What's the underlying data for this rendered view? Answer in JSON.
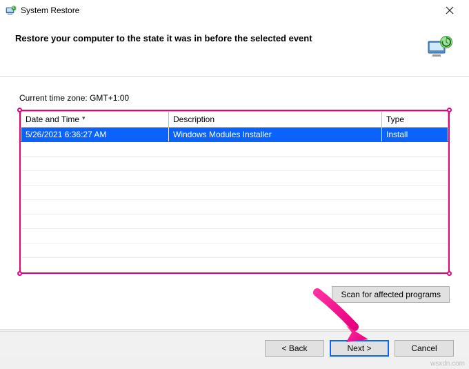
{
  "window": {
    "title": "System Restore"
  },
  "header": {
    "heading": "Restore your computer to the state it was in before the selected event"
  },
  "content": {
    "timezone_label": "Current time zone: GMT+1:00",
    "columns": {
      "datetime": "Date and Time",
      "description": "Description",
      "type": "Type"
    },
    "rows": [
      {
        "datetime": "5/26/2021 6:36:27 AM",
        "description": "Windows Modules Installer",
        "type": "Install",
        "selected": true
      }
    ],
    "empty_row_count": 9,
    "scan_button": "Scan for affected programs"
  },
  "buttons": {
    "back": "< Back",
    "next": "Next >",
    "cancel": "Cancel"
  },
  "watermark": "wsxdn.com",
  "annotation": {
    "highlight_color": "#e6007e"
  }
}
